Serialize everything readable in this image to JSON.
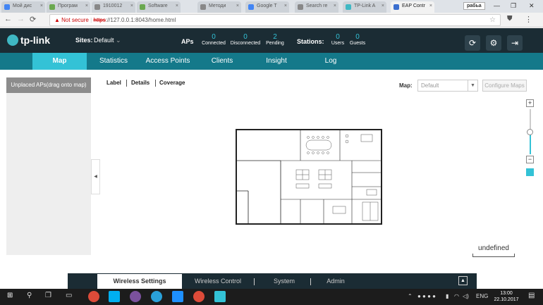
{
  "browser": {
    "tabs": [
      {
        "title": "Мой дис",
        "color": "#4285f4"
      },
      {
        "title": "Програм",
        "color": "#6aa84f"
      },
      {
        "title": "1910012",
        "color": "#888888"
      },
      {
        "title": "Software",
        "color": "#6aa84f"
      },
      {
        "title": "Методи",
        "color": "#888888"
      },
      {
        "title": "Google T",
        "color": "#4285f4"
      },
      {
        "title": "Search re",
        "color": "#888888"
      },
      {
        "title": "TP-Link A",
        "color": "#3fb8c4"
      },
      {
        "title": "EAP Contr",
        "color": "#3b6fcf"
      }
    ],
    "profile": "рабьа",
    "security_label": "Not secure",
    "url_scheme": "https",
    "url_rest": "://127.0.0.1:8043/home.html"
  },
  "header": {
    "brand": "tp-link",
    "sites_label": "Sites:",
    "site_value": "Default",
    "aps_label": "APs",
    "aps_stats": [
      {
        "value": "0",
        "label": "Connected"
      },
      {
        "value": "0",
        "label": "Disconnected"
      },
      {
        "value": "2",
        "label": "Pending"
      }
    ],
    "stations_label": "Stations:",
    "station_stats": [
      {
        "value": "0",
        "label": "Users"
      },
      {
        "value": "0",
        "label": "Guests"
      }
    ]
  },
  "nav": {
    "tabs": [
      "Map",
      "Statistics",
      "Access Points",
      "Clients",
      "Insight",
      "Log"
    ],
    "active": "Map"
  },
  "left_panel": {
    "title": "Unplaced APs(drag onto map)"
  },
  "map_view": {
    "views": [
      "Label",
      "Details",
      "Coverage"
    ],
    "map_label": "Map:",
    "map_placeholder": "Default",
    "configure_button": "Configure Maps",
    "scale_text": "undefined"
  },
  "bottom_bar": {
    "tabs": [
      "Wireless Settings",
      "Wireless Control",
      "System",
      "Admin"
    ],
    "active": "Wireless Settings"
  },
  "taskbar": {
    "lang": "ENG",
    "time": "13:00",
    "date": "22.10.2017"
  },
  "colors": {
    "accent": "#33c2d6",
    "nav_bg": "#14798a",
    "header_bg": "#1b2c34"
  }
}
